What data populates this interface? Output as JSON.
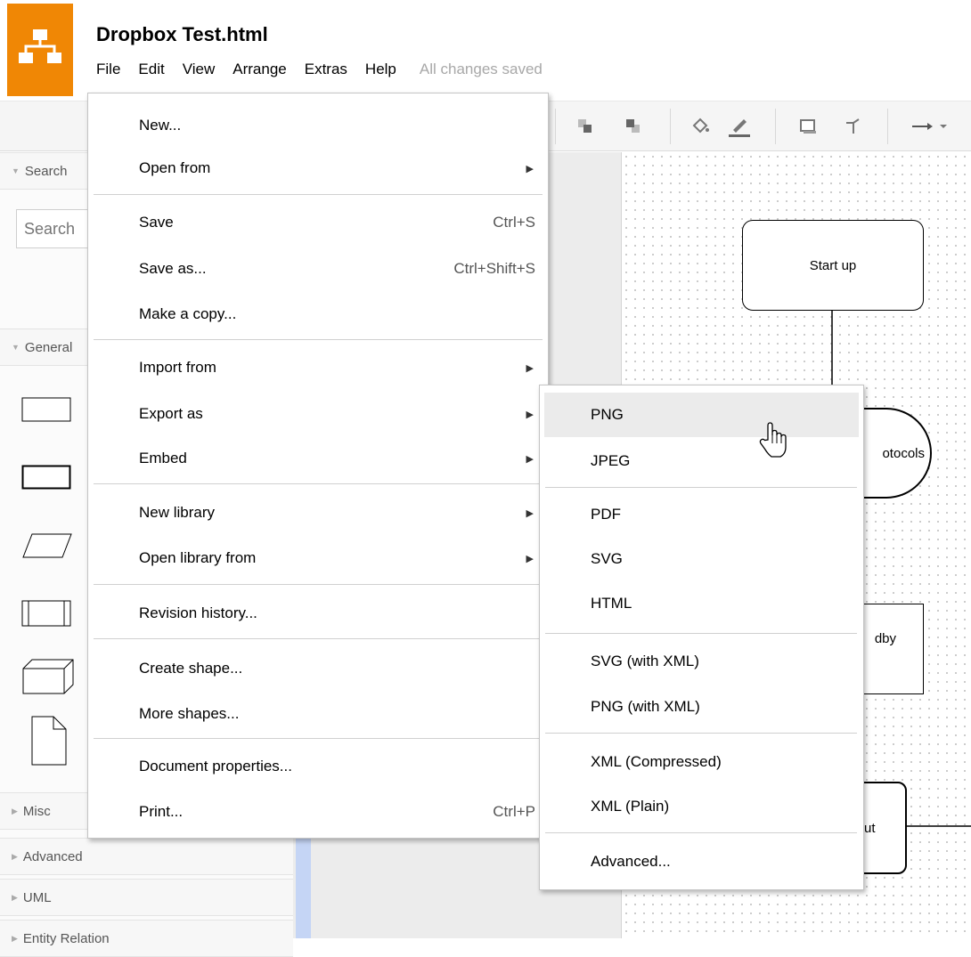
{
  "app": {
    "document_title": "Dropbox Test.html",
    "save_status": "All changes saved",
    "menubar": [
      "File",
      "Edit",
      "View",
      "Arrange",
      "Extras",
      "Help"
    ]
  },
  "sidebar": {
    "search_header": "Search",
    "search_placeholder": "Search",
    "general_header": "General",
    "misc_header": "Misc",
    "advanced_header": "Advanced",
    "uml_header": "UML",
    "er_header": "Entity Relation"
  },
  "canvas": {
    "start_node": "Start up",
    "protocols_node": "otocols",
    "standby_node": "dby",
    "bottom_node": "ut"
  },
  "file_menu": {
    "new": "New...",
    "open_from": "Open from",
    "save": "Save",
    "save_shortcut": "Ctrl+S",
    "save_as": "Save as...",
    "save_as_shortcut": "Ctrl+Shift+S",
    "make_copy": "Make a copy...",
    "import_from": "Import from",
    "export_as": "Export as",
    "embed": "Embed",
    "new_library": "New library",
    "open_library_from": "Open library from",
    "revision_history": "Revision history...",
    "create_shape": "Create shape...",
    "more_shapes": "More shapes...",
    "document_properties": "Document properties...",
    "print": "Print...",
    "print_shortcut": "Ctrl+P"
  },
  "export_menu": {
    "png": "PNG",
    "jpeg": "JPEG",
    "pdf": "PDF",
    "svg": "SVG",
    "html": "HTML",
    "svg_xml": "SVG (with XML)",
    "png_xml": "PNG (with XML)",
    "xml_compressed": "XML (Compressed)",
    "xml_plain": "XML (Plain)",
    "advanced": "Advanced..."
  },
  "colors": {
    "brand": "#f08705",
    "menu_hover": "#ebebeb",
    "save_status": "#a8a8a8"
  },
  "icons": [
    "app-logo-icon",
    "to-front-icon",
    "to-back-icon",
    "fill-color-icon",
    "line-color-icon",
    "shadow-icon",
    "waypoint-icon",
    "connection-arrow-icon",
    "submenu-arrow-icon",
    "hand-cursor-icon"
  ]
}
